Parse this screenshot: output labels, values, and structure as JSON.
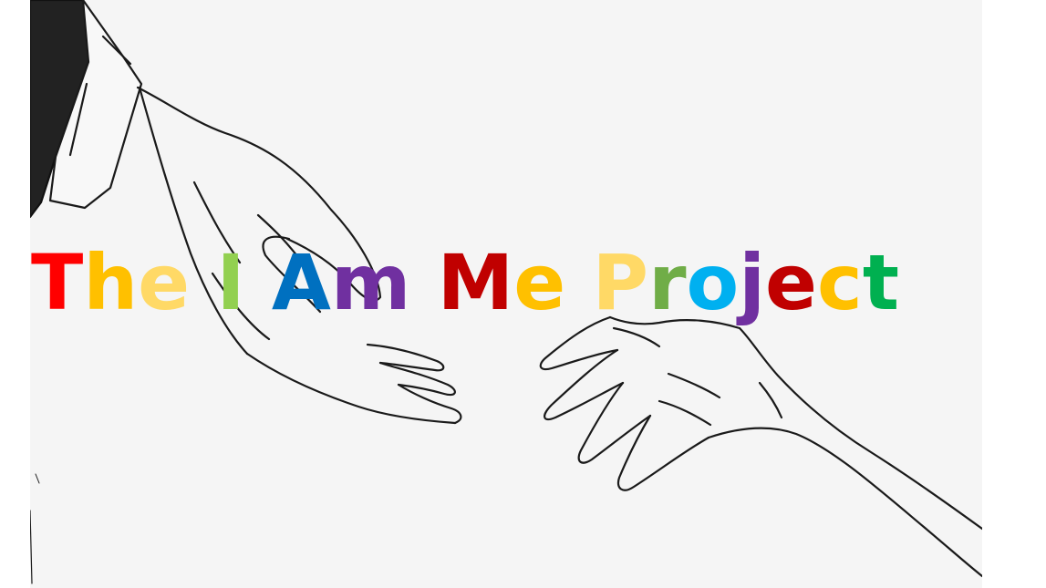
{
  "title": {
    "text": "The I Am Me Project",
    "letters": [
      {
        "ch": "T",
        "color": "#ff0000"
      },
      {
        "ch": "h",
        "color": "#ffc000"
      },
      {
        "ch": "e",
        "color": "#ffd966"
      },
      {
        "ch": " ",
        "color": "#000000"
      },
      {
        "ch": "I",
        "color": "#92d050"
      },
      {
        "ch": " ",
        "color": "#000000"
      },
      {
        "ch": "A",
        "color": "#0070c0"
      },
      {
        "ch": "m",
        "color": "#7030a0"
      },
      {
        "ch": " ",
        "color": "#000000"
      },
      {
        "ch": "M",
        "color": "#c00000"
      },
      {
        "ch": "e",
        "color": "#ffc000"
      },
      {
        "ch": " ",
        "color": "#000000"
      },
      {
        "ch": "P",
        "color": "#ffd966"
      },
      {
        "ch": "r",
        "color": "#70ad47"
      },
      {
        "ch": "o",
        "color": "#00b0f0"
      },
      {
        "ch": "j",
        "color": "#7030a0"
      },
      {
        "ch": "e",
        "color": "#c00000"
      },
      {
        "ch": "c",
        "color": "#ffc000"
      },
      {
        "ch": "t",
        "color": "#00b050"
      }
    ]
  },
  "illustration": {
    "background": "#f5f5f5",
    "line_color": "#1a1a1a"
  }
}
